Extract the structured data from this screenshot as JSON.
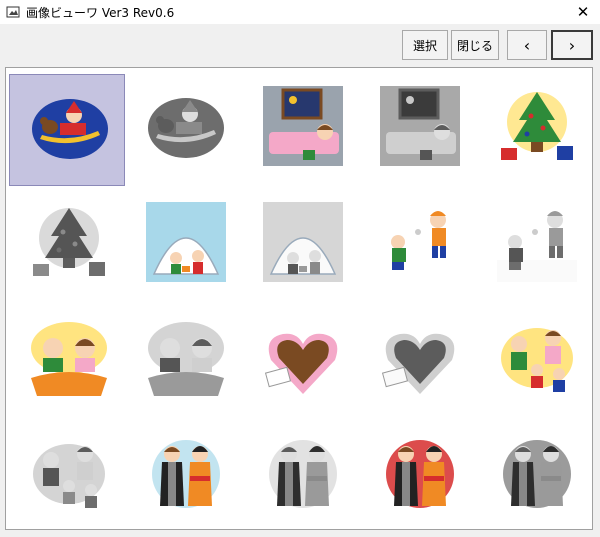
{
  "window": {
    "title": "画像ビューワ Ver3 Rev0.6",
    "close_glyph": "✕"
  },
  "toolbar": {
    "select_label": "選択",
    "close_label": "閉じる",
    "prev_label": "‹",
    "next_label": "›"
  },
  "thumbnails": [
    {
      "subject": "santa-sleigh",
      "mode": "color",
      "selected": true
    },
    {
      "subject": "santa-sleigh",
      "mode": "gray"
    },
    {
      "subject": "sleeping-child",
      "mode": "color"
    },
    {
      "subject": "sleeping-child",
      "mode": "gray"
    },
    {
      "subject": "christmas-tree",
      "mode": "color"
    },
    {
      "subject": "christmas-tree",
      "mode": "gray"
    },
    {
      "subject": "snow-igloo",
      "mode": "color"
    },
    {
      "subject": "snow-igloo",
      "mode": "gray"
    },
    {
      "subject": "snowball-kids",
      "mode": "color"
    },
    {
      "subject": "snowball-kids",
      "mode": "gray"
    },
    {
      "subject": "couple-gifts",
      "mode": "color"
    },
    {
      "subject": "couple-gifts",
      "mode": "gray"
    },
    {
      "subject": "heart-chocolate",
      "mode": "color"
    },
    {
      "subject": "heart-chocolate",
      "mode": "gray"
    },
    {
      "subject": "family-playing",
      "mode": "color"
    },
    {
      "subject": "family-playing",
      "mode": "gray"
    },
    {
      "subject": "kimono-couple",
      "mode": "color"
    },
    {
      "subject": "kimono-couple",
      "mode": "gray"
    },
    {
      "subject": "kimono-couple-sun",
      "mode": "color"
    },
    {
      "subject": "kimono-couple-sun",
      "mode": "gray"
    }
  ],
  "colors": {
    "selection": "#c5c3e0",
    "title_bg": "#ffffff",
    "window_bg": "#f0f0f0"
  }
}
